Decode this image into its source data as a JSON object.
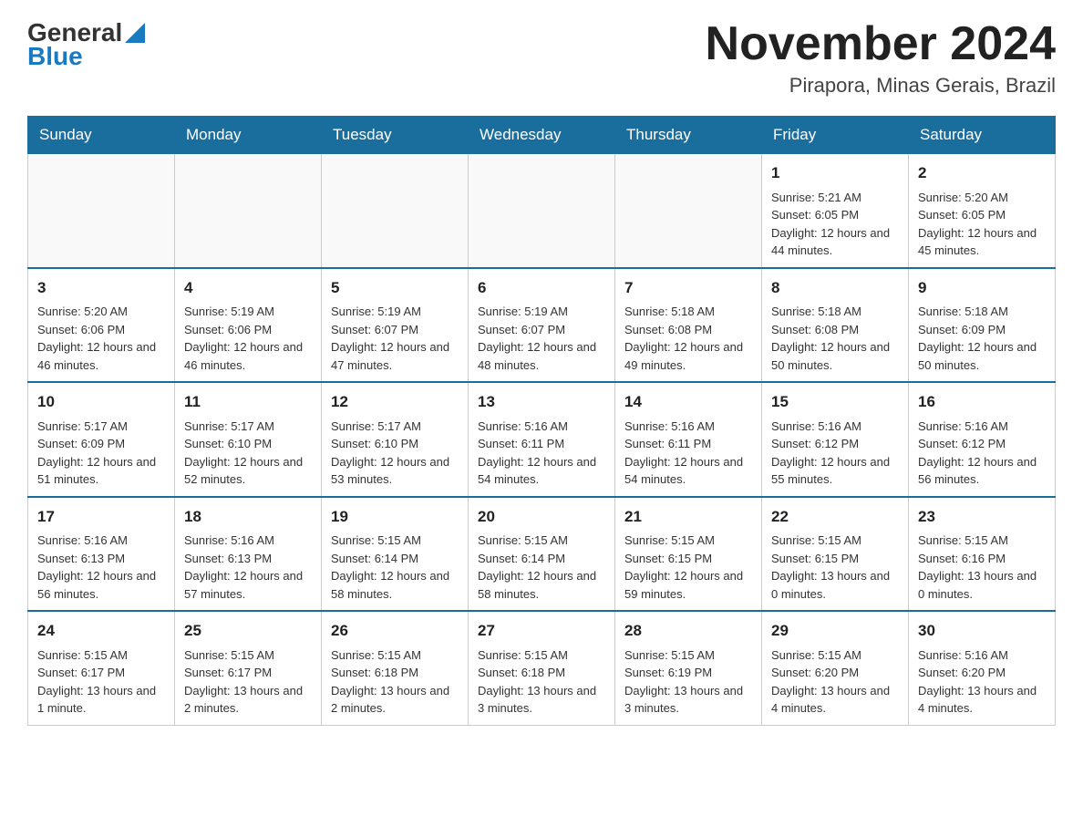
{
  "logo": {
    "general": "General",
    "blue": "Blue"
  },
  "title": "November 2024",
  "location": "Pirapora, Minas Gerais, Brazil",
  "weekdays": [
    "Sunday",
    "Monday",
    "Tuesday",
    "Wednesday",
    "Thursday",
    "Friday",
    "Saturday"
  ],
  "weeks": [
    [
      {
        "day": "",
        "info": ""
      },
      {
        "day": "",
        "info": ""
      },
      {
        "day": "",
        "info": ""
      },
      {
        "day": "",
        "info": ""
      },
      {
        "day": "",
        "info": ""
      },
      {
        "day": "1",
        "info": "Sunrise: 5:21 AM\nSunset: 6:05 PM\nDaylight: 12 hours and 44 minutes."
      },
      {
        "day": "2",
        "info": "Sunrise: 5:20 AM\nSunset: 6:05 PM\nDaylight: 12 hours and 45 minutes."
      }
    ],
    [
      {
        "day": "3",
        "info": "Sunrise: 5:20 AM\nSunset: 6:06 PM\nDaylight: 12 hours and 46 minutes."
      },
      {
        "day": "4",
        "info": "Sunrise: 5:19 AM\nSunset: 6:06 PM\nDaylight: 12 hours and 46 minutes."
      },
      {
        "day": "5",
        "info": "Sunrise: 5:19 AM\nSunset: 6:07 PM\nDaylight: 12 hours and 47 minutes."
      },
      {
        "day": "6",
        "info": "Sunrise: 5:19 AM\nSunset: 6:07 PM\nDaylight: 12 hours and 48 minutes."
      },
      {
        "day": "7",
        "info": "Sunrise: 5:18 AM\nSunset: 6:08 PM\nDaylight: 12 hours and 49 minutes."
      },
      {
        "day": "8",
        "info": "Sunrise: 5:18 AM\nSunset: 6:08 PM\nDaylight: 12 hours and 50 minutes."
      },
      {
        "day": "9",
        "info": "Sunrise: 5:18 AM\nSunset: 6:09 PM\nDaylight: 12 hours and 50 minutes."
      }
    ],
    [
      {
        "day": "10",
        "info": "Sunrise: 5:17 AM\nSunset: 6:09 PM\nDaylight: 12 hours and 51 minutes."
      },
      {
        "day": "11",
        "info": "Sunrise: 5:17 AM\nSunset: 6:10 PM\nDaylight: 12 hours and 52 minutes."
      },
      {
        "day": "12",
        "info": "Sunrise: 5:17 AM\nSunset: 6:10 PM\nDaylight: 12 hours and 53 minutes."
      },
      {
        "day": "13",
        "info": "Sunrise: 5:16 AM\nSunset: 6:11 PM\nDaylight: 12 hours and 54 minutes."
      },
      {
        "day": "14",
        "info": "Sunrise: 5:16 AM\nSunset: 6:11 PM\nDaylight: 12 hours and 54 minutes."
      },
      {
        "day": "15",
        "info": "Sunrise: 5:16 AM\nSunset: 6:12 PM\nDaylight: 12 hours and 55 minutes."
      },
      {
        "day": "16",
        "info": "Sunrise: 5:16 AM\nSunset: 6:12 PM\nDaylight: 12 hours and 56 minutes."
      }
    ],
    [
      {
        "day": "17",
        "info": "Sunrise: 5:16 AM\nSunset: 6:13 PM\nDaylight: 12 hours and 56 minutes."
      },
      {
        "day": "18",
        "info": "Sunrise: 5:16 AM\nSunset: 6:13 PM\nDaylight: 12 hours and 57 minutes."
      },
      {
        "day": "19",
        "info": "Sunrise: 5:15 AM\nSunset: 6:14 PM\nDaylight: 12 hours and 58 minutes."
      },
      {
        "day": "20",
        "info": "Sunrise: 5:15 AM\nSunset: 6:14 PM\nDaylight: 12 hours and 58 minutes."
      },
      {
        "day": "21",
        "info": "Sunrise: 5:15 AM\nSunset: 6:15 PM\nDaylight: 12 hours and 59 minutes."
      },
      {
        "day": "22",
        "info": "Sunrise: 5:15 AM\nSunset: 6:15 PM\nDaylight: 13 hours and 0 minutes."
      },
      {
        "day": "23",
        "info": "Sunrise: 5:15 AM\nSunset: 6:16 PM\nDaylight: 13 hours and 0 minutes."
      }
    ],
    [
      {
        "day": "24",
        "info": "Sunrise: 5:15 AM\nSunset: 6:17 PM\nDaylight: 13 hours and 1 minute."
      },
      {
        "day": "25",
        "info": "Sunrise: 5:15 AM\nSunset: 6:17 PM\nDaylight: 13 hours and 2 minutes."
      },
      {
        "day": "26",
        "info": "Sunrise: 5:15 AM\nSunset: 6:18 PM\nDaylight: 13 hours and 2 minutes."
      },
      {
        "day": "27",
        "info": "Sunrise: 5:15 AM\nSunset: 6:18 PM\nDaylight: 13 hours and 3 minutes."
      },
      {
        "day": "28",
        "info": "Sunrise: 5:15 AM\nSunset: 6:19 PM\nDaylight: 13 hours and 3 minutes."
      },
      {
        "day": "29",
        "info": "Sunrise: 5:15 AM\nSunset: 6:20 PM\nDaylight: 13 hours and 4 minutes."
      },
      {
        "day": "30",
        "info": "Sunrise: 5:16 AM\nSunset: 6:20 PM\nDaylight: 13 hours and 4 minutes."
      }
    ]
  ]
}
